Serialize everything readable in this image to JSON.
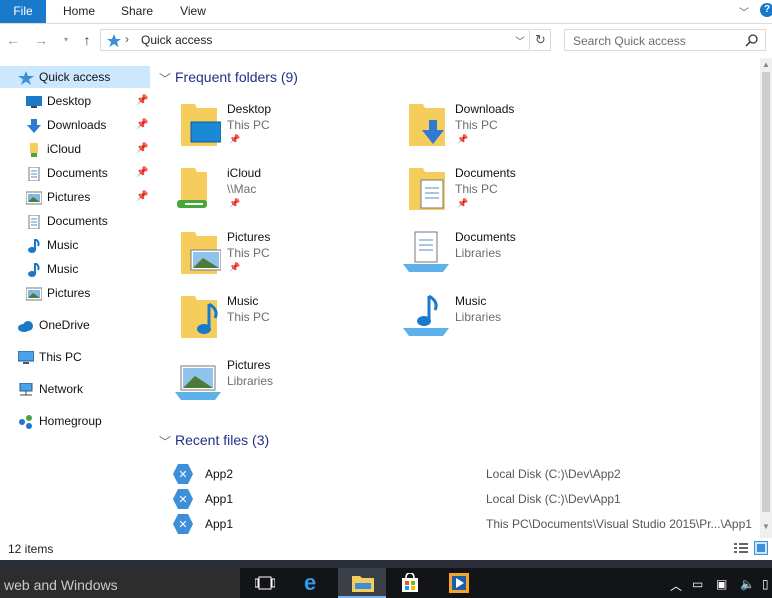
{
  "ribbon": {
    "tabs": [
      "File",
      "Home",
      "Share",
      "View"
    ],
    "help_label": "?"
  },
  "address": {
    "location": "Quick access",
    "search_placeholder": "Search Quick access"
  },
  "sidebar": {
    "items": [
      {
        "label": "Quick access",
        "icon": "star-icon",
        "pinned": false
      },
      {
        "label": "Desktop",
        "icon": "desktop-icon",
        "pinned": true
      },
      {
        "label": "Downloads",
        "icon": "download-arrow-icon",
        "pinned": true
      },
      {
        "label": "iCloud",
        "icon": "icloud-drive-icon",
        "pinned": true
      },
      {
        "label": "Documents",
        "icon": "documents-icon",
        "pinned": true
      },
      {
        "label": "Pictures",
        "icon": "pictures-icon",
        "pinned": true
      },
      {
        "label": "Documents",
        "icon": "documents-icon",
        "pinned": false
      },
      {
        "label": "Music",
        "icon": "music-note-icon",
        "pinned": false
      },
      {
        "label": "Music",
        "icon": "music-note-icon",
        "pinned": false
      },
      {
        "label": "Pictures",
        "icon": "pictures-icon",
        "pinned": false
      },
      {
        "label": "OneDrive",
        "icon": "cloud-icon",
        "pinned": false
      },
      {
        "label": "This PC",
        "icon": "computer-icon",
        "pinned": false
      },
      {
        "label": "Network",
        "icon": "network-icon",
        "pinned": false
      },
      {
        "label": "Homegroup",
        "icon": "homegroup-icon",
        "pinned": false
      }
    ]
  },
  "frequent": {
    "header": "Frequent folders (9)",
    "folders": [
      {
        "name": "Desktop",
        "location": "This PC",
        "pinned": true
      },
      {
        "name": "Downloads",
        "location": "This PC",
        "pinned": true
      },
      {
        "name": "iCloud",
        "location": "\\\\Mac",
        "pinned": true
      },
      {
        "name": "Documents",
        "location": "This PC",
        "pinned": true
      },
      {
        "name": "Pictures",
        "location": "This PC",
        "pinned": true
      },
      {
        "name": "Documents",
        "location": "Libraries",
        "pinned": false
      },
      {
        "name": "Music",
        "location": "This PC",
        "pinned": false
      },
      {
        "name": "Music",
        "location": "Libraries",
        "pinned": false
      },
      {
        "name": "Pictures",
        "location": "Libraries",
        "pinned": false
      }
    ]
  },
  "recent": {
    "header": "Recent files (3)",
    "files": [
      {
        "name": "App2",
        "path": "Local Disk (C:)\\Dev\\App2"
      },
      {
        "name": "App1",
        "path": "Local Disk (C:)\\Dev\\App1"
      },
      {
        "name": "App1",
        "path": "This PC\\Documents\\Visual Studio 2015\\Pr...\\App1"
      }
    ]
  },
  "status": {
    "item_count": "12 items"
  },
  "taskbar": {
    "search_text": "web and Windows"
  },
  "colors": {
    "accent": "#1979ca",
    "selection": "#cce8ff",
    "header_text": "#1e3287",
    "folder_yellow": "#f5cd5c"
  }
}
